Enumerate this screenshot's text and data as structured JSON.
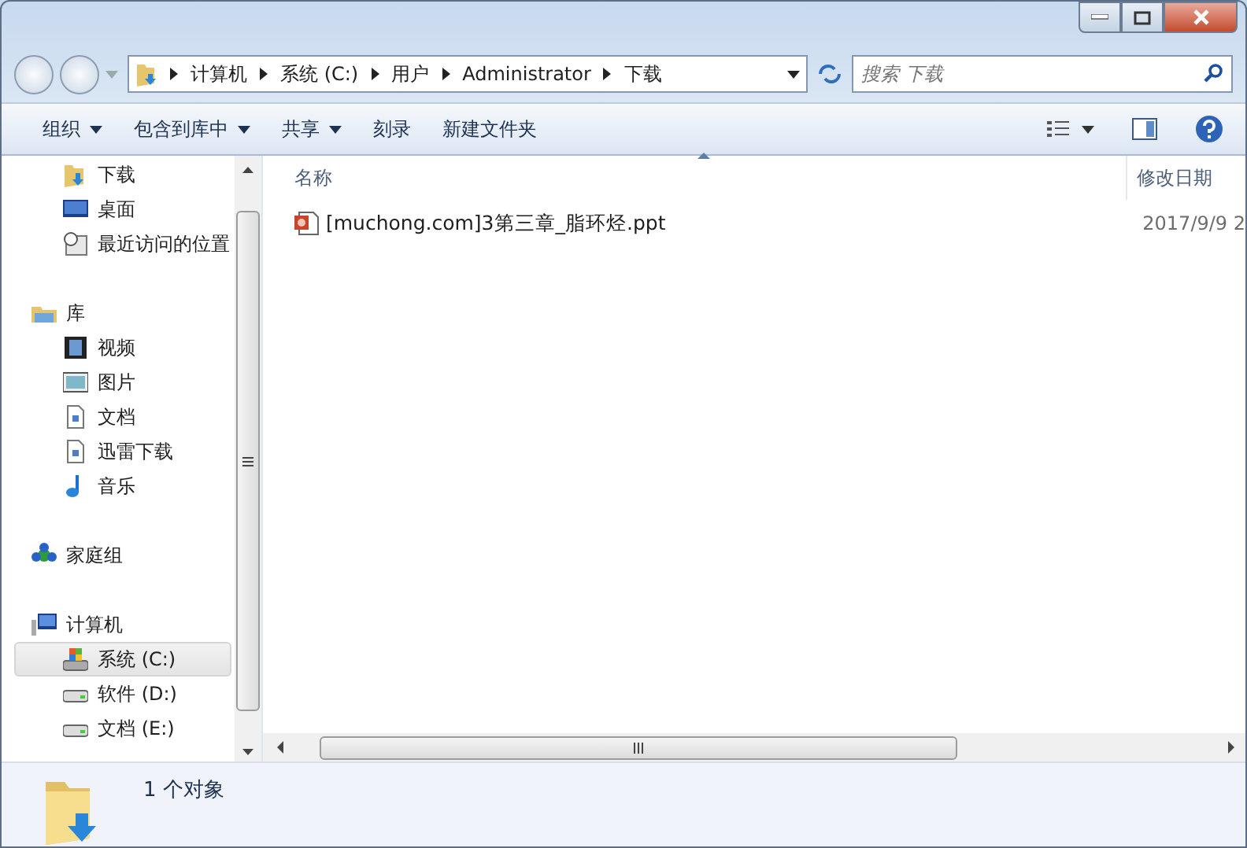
{
  "address": {
    "segments": [
      "计算机",
      "系统 (C:)",
      "用户",
      "Administrator",
      "下载"
    ]
  },
  "search": {
    "placeholder": "搜索 下载"
  },
  "toolbar": [
    {
      "label": "组织",
      "dropdown": true
    },
    {
      "label": "包含到库中",
      "dropdown": true
    },
    {
      "label": "共享",
      "dropdown": true
    },
    {
      "label": "刻录",
      "dropdown": false
    },
    {
      "label": "新建文件夹",
      "dropdown": false
    }
  ],
  "navigation": [
    {
      "children": [
        {
          "label": "下载",
          "kind": "downloads",
          "selected": false
        },
        {
          "label": "桌面",
          "kind": "desktop",
          "selected": false
        },
        {
          "label": "最近访问的位置",
          "kind": "recent",
          "selected": false
        }
      ]
    },
    {
      "label": "库",
      "kind": "library",
      "selected": false,
      "children": [
        {
          "label": "视频",
          "kind": "video",
          "selected": false
        },
        {
          "label": "图片",
          "kind": "picture",
          "selected": false
        },
        {
          "label": "文档",
          "kind": "document",
          "selected": false
        },
        {
          "label": "迅雷下载",
          "kind": "document",
          "selected": false
        },
        {
          "label": "音乐",
          "kind": "music",
          "selected": false
        }
      ]
    },
    {
      "label": "家庭组",
      "kind": "homegroup",
      "selected": false
    },
    {
      "label": "计算机",
      "kind": "computer",
      "selected": false,
      "children": [
        {
          "label": "系统 (C:)",
          "kind": "system-drive",
          "selected": true
        },
        {
          "label": "软件 (D:)",
          "kind": "drive",
          "selected": false
        },
        {
          "label": "文档 (E:)",
          "kind": "drive",
          "selected": false
        }
      ]
    }
  ],
  "table": {
    "columns": [
      "名称",
      "修改日期"
    ],
    "rows": [
      {
        "name": "[muchong.com]3第三章_脂环烃.ppt",
        "modified": "2017/9/9 2"
      }
    ]
  },
  "details": {
    "count": "1 个对象"
  }
}
